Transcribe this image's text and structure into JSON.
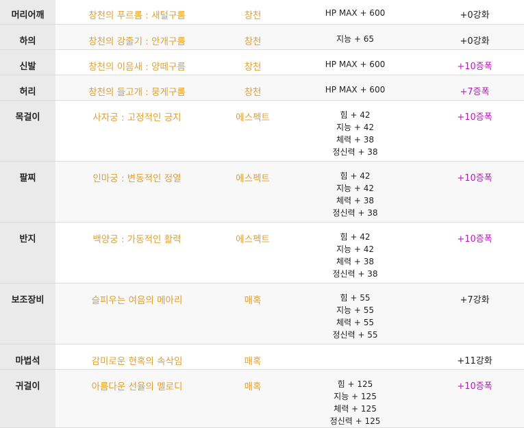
{
  "colors": {
    "item_name": "#e0a030",
    "amplify": "#b01fb0",
    "enhance": "#222222",
    "slot_bg": "#eaeaea"
  },
  "rows": [
    {
      "slot": "머리어깨",
      "item": "창천의 푸르름 : 새털구름",
      "set": "창천",
      "stats": [
        "HP MAX + 600"
      ],
      "upgrade": "+0강화",
      "upgrade_type": "enhance"
    },
    {
      "slot": "하의",
      "item": "창천의 강줄기 : 안개구름",
      "set": "창천",
      "stats": [
        "지능 + 65"
      ],
      "upgrade": "+0강화",
      "upgrade_type": "enhance"
    },
    {
      "slot": "신발",
      "item": "창천의 이음새 : 양떼구름",
      "set": "창천",
      "stats": [
        "HP MAX + 600"
      ],
      "upgrade": "+10증폭",
      "upgrade_type": "amplify"
    },
    {
      "slot": "허리",
      "item": "창천의 들고개 : 뭉게구름",
      "set": "창천",
      "stats": [
        "HP MAX + 600"
      ],
      "upgrade": "+7증폭",
      "upgrade_type": "amplify"
    },
    {
      "slot": "목걸이",
      "item": "사자궁 : 고정적인 긍지",
      "set": "에스펙트",
      "stats": [
        "힘 + 42",
        "지능 + 42",
        "체력 + 38",
        "정신력 + 38"
      ],
      "upgrade": "+10증폭",
      "upgrade_type": "amplify"
    },
    {
      "slot": "팔찌",
      "item": "인마궁 : 변동적인 정열",
      "set": "에스펙트",
      "stats": [
        "힘 + 42",
        "지능 + 42",
        "체력 + 38",
        "정신력 + 38"
      ],
      "upgrade": "+10증폭",
      "upgrade_type": "amplify"
    },
    {
      "slot": "반지",
      "item": "백양궁 : 가동적인 활력",
      "set": "에스펙트",
      "stats": [
        "힘 + 42",
        "지능 + 42",
        "체력 + 38",
        "정신력 + 38"
      ],
      "upgrade": "+10증폭",
      "upgrade_type": "amplify"
    },
    {
      "slot": "보조장비",
      "item": "슬피우는 여음의 메아리",
      "set": "매혹",
      "stats": [
        "힘 + 55",
        "지능 + 55",
        "체력 + 55",
        "정신력 + 55"
      ],
      "upgrade": "+7강화",
      "upgrade_type": "enhance"
    },
    {
      "slot": "마법석",
      "item": "감미로운 현혹의 속삭임",
      "set": "매혹",
      "stats": [],
      "upgrade": "+11강화",
      "upgrade_type": "enhance"
    },
    {
      "slot": "귀걸이",
      "item": "아름다운 선율의 멜로디",
      "set": "매혹",
      "stats": [
        "힘 + 125",
        "지능 + 125",
        "체력 + 125",
        "정신력 + 125"
      ],
      "upgrade": "+10증폭",
      "upgrade_type": "amplify"
    }
  ]
}
